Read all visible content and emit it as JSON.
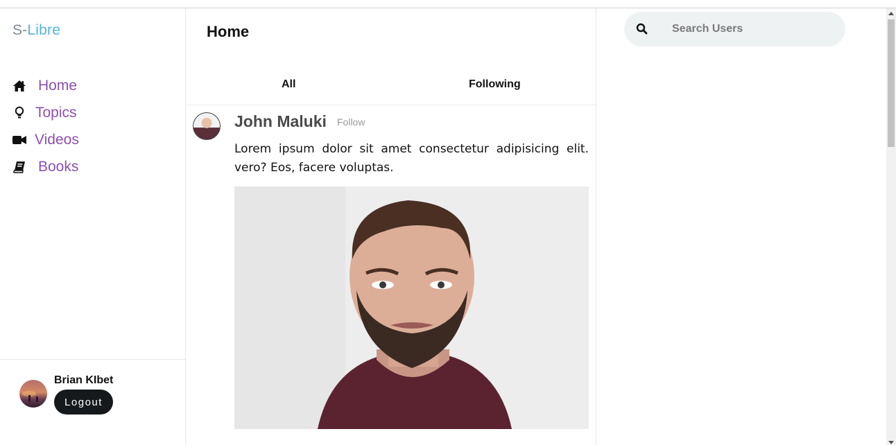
{
  "brand": {
    "prefix": "S-",
    "name": "Libre"
  },
  "sidebar": {
    "items": [
      {
        "label": "Home",
        "icon": "home-icon"
      },
      {
        "label": "Topics",
        "icon": "lightbulb-icon"
      },
      {
        "label": "Videos",
        "icon": "video-camera-icon"
      },
      {
        "label": "Books",
        "icon": "book-icon"
      }
    ],
    "user": {
      "name": "Brian KIbet",
      "logout_label": "Logout"
    }
  },
  "main": {
    "title": "Home",
    "tabs": [
      {
        "label": "All"
      },
      {
        "label": "Following"
      }
    ],
    "post": {
      "author": "John Maluki",
      "follow_label": "Follow",
      "text": "Lorem ipsum dolor sit amet consectetur adipisicing elit. vero? Eos, facere voluptas."
    }
  },
  "search": {
    "placeholder": "Search Users",
    "icon": "search-icon"
  },
  "colors": {
    "nav_label": "#8b4fb0",
    "brand_accent": "#52b4d8",
    "logout_bg": "#16191c",
    "search_bg": "#eff2f3"
  }
}
